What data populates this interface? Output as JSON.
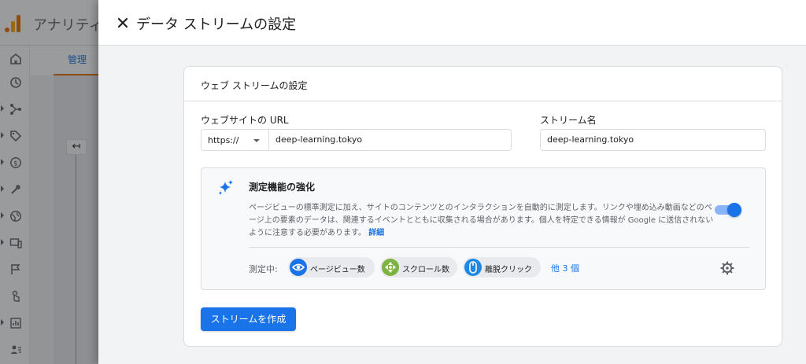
{
  "background": {
    "app_title": "アナリティ",
    "tab_label": "管理",
    "back_glyph": "↤",
    "rail_icons": [
      "home-icon",
      "reports-icon",
      "explore-icon",
      "advertising-icon",
      "monetization-icon",
      "configure-icon",
      "globe-icon",
      "devices-icon",
      "flag-icon",
      "touch-icon",
      "data-icon",
      "users-icon"
    ]
  },
  "sheet": {
    "title": "データ ストリームの設定",
    "card_title": "ウェブ ストリームの設定",
    "url_label": "ウェブサイトの URL",
    "protocol_value": "https://",
    "url_value": "deep-learning.tokyo",
    "stream_name_label": "ストリーム名",
    "stream_name_value": "deep-learning.tokyo",
    "enhanced": {
      "title": "測定機能の強化",
      "description": "ページビューの標準測定に加え、サイトのコンテンツとのインタラクションを自動的に測定します。リンクや埋め込み動画などのページ上の要素のデータは、関連するイベントとともに収集される場合があります。個人を特定できる情報が Google に送信されないように注意する必要があります。",
      "detail_link": "詳細",
      "enabled": true,
      "measuring_label": "測定中:",
      "chips": [
        {
          "label": "ページビュー数",
          "icon": "eye-icon",
          "color": "#1a73e8"
        },
        {
          "label": "スクロール数",
          "icon": "scroll-icon",
          "color": "#7cb342"
        },
        {
          "label": "離脱クリック",
          "icon": "mouse-icon",
          "color": "#1e88e5"
        }
      ],
      "more_link": "他 3 個"
    },
    "create_button": "ストリームを作成"
  },
  "colors": {
    "accent": "#1a73e8",
    "brand_orange": "#e37400"
  }
}
